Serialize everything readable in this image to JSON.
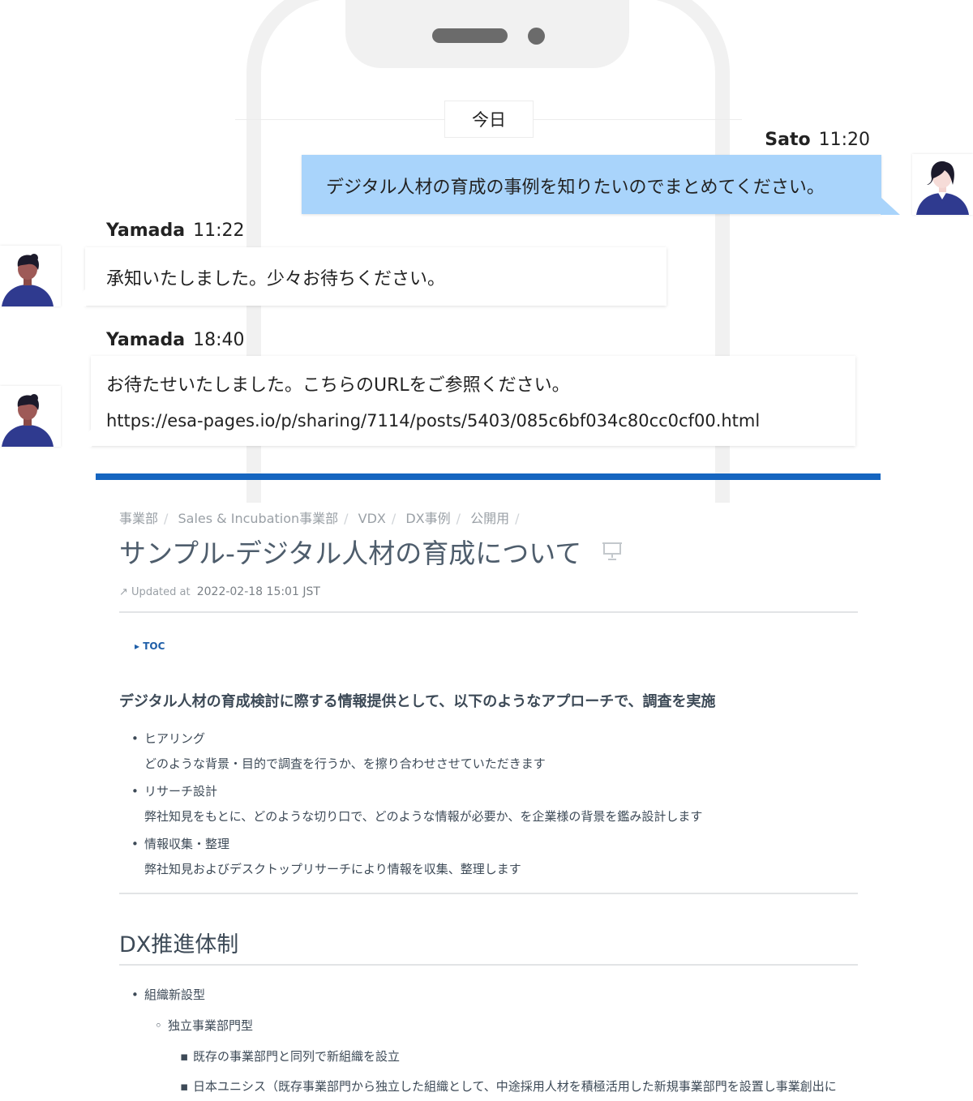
{
  "chat": {
    "date_divider": "今日",
    "messages": [
      {
        "sender": "Sato",
        "time": "11:20",
        "text": "デジタル人材の育成の事例を知りたいのでまとめてください。"
      },
      {
        "sender": "Yamada",
        "time": "11:22",
        "text": "承知いたしました。少々お待ちください。"
      },
      {
        "sender": "Yamada",
        "time": "18:40",
        "text": "お待たせいたしました。こちらのURLをご参照ください。",
        "link": "https://esa-pages.io/p/sharing/7114/posts/5403/085c6bf034c80cc0cf00.html"
      }
    ]
  },
  "doc": {
    "breadcrumb": [
      "事業部",
      "Sales & Incubation事業部",
      "VDX",
      "DX事例",
      "公開用"
    ],
    "title": "サンプル-デジタル人材の育成について",
    "updated_label": "Updated at",
    "updated_at": "2022-02-18 15:01 JST",
    "toc_label": "TOC",
    "lead": "デジタル人材の育成検討に際する情報提供として、以下のようなアプローチで、調査を実施",
    "approaches": [
      {
        "title": "ヒアリング",
        "desc": "どのような背景・目的で調査を行うか、を擦り合わせさせていただきます"
      },
      {
        "title": "リサーチ設計",
        "desc": "弊社知見をもとに、どのような切り口で、どのような情報が必要か、を企業様の背景を鑑み設計します"
      },
      {
        "title": "情報収集・整理",
        "desc": "弊社知見およびデスクトップリサーチにより情報を収集、整理します"
      }
    ],
    "section_title": "DX推進体制",
    "list": {
      "l1": "組織新設型",
      "l2": "独立事業部門型",
      "l3": [
        "既存の事業部門と同列で新組織を設立",
        "日本ユニシス（既存事業部門から独立した組織として、中途採用人材を積極活用した新規事業部門を設置し事業創出に"
      ]
    }
  },
  "colors": {
    "sent_bubble": "#a9d4fb",
    "accent_bar": "#1565c0",
    "avatar_shirt": "#2f3a8f",
    "avatar_skin": "#9e5a57"
  }
}
